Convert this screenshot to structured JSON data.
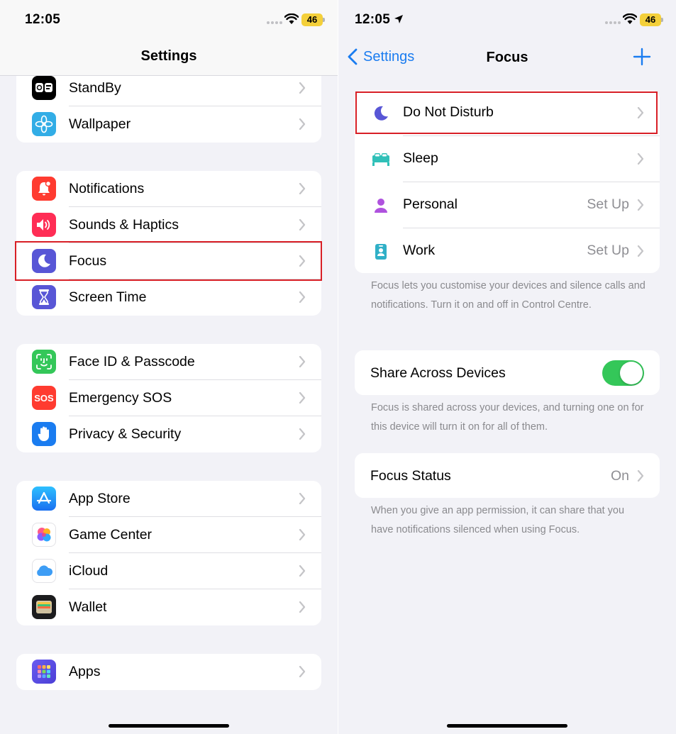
{
  "left": {
    "status": {
      "time": "12:05",
      "battery": "46"
    },
    "title": "Settings",
    "groups": [
      {
        "items": [
          {
            "label": "StandBy",
            "icon": "standby-icon",
            "color": "#000000"
          },
          {
            "label": "Wallpaper",
            "icon": "wallpaper-icon",
            "color": "#32ade6"
          }
        ]
      },
      {
        "items": [
          {
            "label": "Notifications",
            "icon": "bell-icon",
            "color": "#ff3b30"
          },
          {
            "label": "Sounds & Haptics",
            "icon": "speaker-icon",
            "color": "#ff2d55"
          },
          {
            "label": "Focus",
            "icon": "moon-icon",
            "color": "#5856d6"
          },
          {
            "label": "Screen Time",
            "icon": "hourglass-icon",
            "color": "#5856d6"
          }
        ]
      },
      {
        "items": [
          {
            "label": "Face ID & Passcode",
            "icon": "face-id-icon",
            "color": "#34c759"
          },
          {
            "label": "Emergency SOS",
            "icon": "sos-icon",
            "color": "#ff3b30",
            "icon_text": "SOS"
          },
          {
            "label": "Privacy & Security",
            "icon": "hand-icon",
            "color": "#1a7cf0"
          }
        ]
      },
      {
        "items": [
          {
            "label": "App Store",
            "icon": "app-store-icon",
            "color": "#1a8cff"
          },
          {
            "label": "Game Center",
            "icon": "game-center-icon",
            "color": "#ffffff"
          },
          {
            "label": "iCloud",
            "icon": "cloud-icon",
            "color": "#ffffff"
          },
          {
            "label": "Wallet",
            "icon": "wallet-icon",
            "color": "#000000"
          }
        ]
      },
      {
        "items": [
          {
            "label": "Apps",
            "icon": "apps-grid-icon",
            "color": "#5856d6"
          }
        ]
      }
    ]
  },
  "right": {
    "status": {
      "time": "12:05",
      "battery": "46"
    },
    "nav": {
      "back_label": "Settings",
      "title": "Focus"
    },
    "focus_modes": [
      {
        "label": "Do Not Disturb",
        "value": "",
        "icon": "moon-icon",
        "color": "#5856d6"
      },
      {
        "label": "Sleep",
        "value": "",
        "icon": "bed-icon",
        "color": "#30c0b8"
      },
      {
        "label": "Personal",
        "value": "Set Up",
        "icon": "person-icon",
        "color": "#af52de"
      },
      {
        "label": "Work",
        "value": "Set Up",
        "icon": "id-badge-icon",
        "color": "#30b0c7"
      }
    ],
    "focus_footnote": "Focus lets you customise your devices and silence calls and notifications. Turn it on and off in Control Centre.",
    "share": {
      "label": "Share Across Devices",
      "enabled": true
    },
    "share_footnote": "Focus is shared across your devices, and turning one on for this device will turn it on for all of them.",
    "status_row": {
      "label": "Focus Status",
      "value": "On"
    },
    "status_footnote": "When you give an app permission, it can share that you have notifications silenced when using Focus."
  },
  "colors": {
    "accent": "#1a7cf0",
    "highlight": "#d81f26",
    "toggle_on": "#34c759"
  }
}
